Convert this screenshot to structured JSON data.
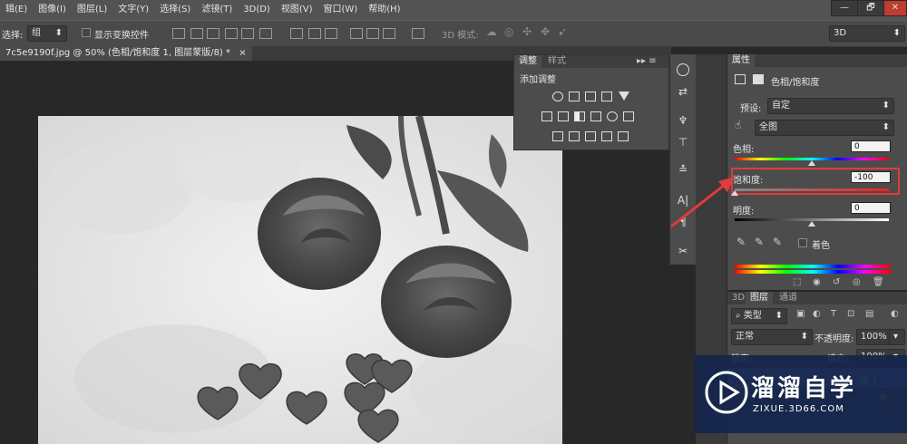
{
  "menubar": {
    "items": [
      "辑(E)",
      "图像(I)",
      "图层(L)",
      "文字(Y)",
      "选择(S)",
      "滤镜(T)",
      "3D(D)",
      "视图(V)",
      "窗口(W)",
      "帮助(H)"
    ],
    "minimize": "—",
    "restore": "🗗",
    "close": "✕"
  },
  "options": {
    "select_label": "选择:",
    "select_value": "组",
    "show_transform_label": "显示变换控件",
    "mode_3d_label": "3D 模式:",
    "workspace_value": "3D"
  },
  "document": {
    "tab_title": "7c5e9190f.jpg @ 50% (色相/饱和度 1, 图层蒙版/8) *",
    "close": "×"
  },
  "adjustments": {
    "tab_adjust": "调整",
    "tab_style": "样式",
    "title": "添加调整",
    "menu": "▸▸ ≡"
  },
  "properties": {
    "tab": "属性",
    "title": "色相/饱和度",
    "preset_label": "预设:",
    "preset_value": "自定",
    "channel_value": "全图",
    "hue_label": "色相:",
    "hue_value": "0",
    "hue_level": 0.5,
    "saturation_label": "饱和度:",
    "saturation_value": "-100",
    "saturation_level": 0.0,
    "lightness_label": "明度:",
    "lightness_value": "0",
    "lightness_level": 0.5,
    "colorize_label": "着色"
  },
  "layers": {
    "tab_3d": "3D",
    "tab_layers": "图层",
    "tab_channels": "通道",
    "filter_kind": "类型",
    "blend_mode": "正常",
    "opacity_label": "不透明度:",
    "opacity_value": "100%",
    "fill_value": "100%",
    "lock_label": "锁定:",
    "fill_label": "填充:",
    "layer_name_partial": "度 1"
  },
  "watermark": {
    "title": "溜溜自学",
    "url": "ZIXUE.3D66.COM"
  },
  "colors": {
    "accent_red": "#e13b3b",
    "panel_bg": "#4c4c4c",
    "watermark_bg": "#14264c"
  }
}
